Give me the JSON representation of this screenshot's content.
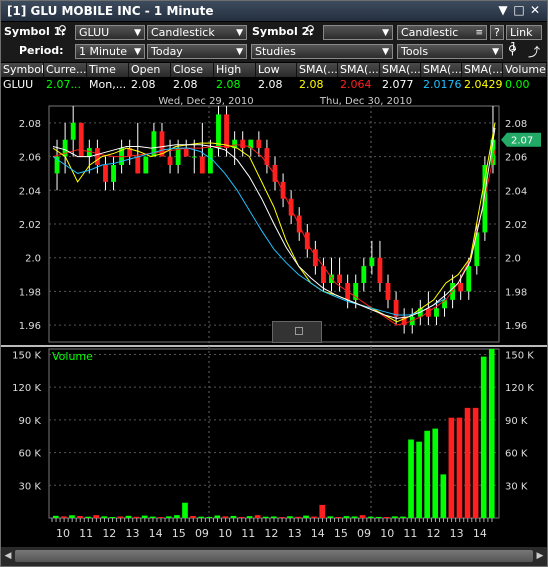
{
  "window": {
    "title": "[1] GLU MOBILE INC - 1 Minute",
    "buttons": [
      "▼",
      "□",
      "✕"
    ]
  },
  "toolbar": {
    "symbol1_label": "Symbol 1:",
    "symbol1_value": "GLUU",
    "chart_style_1": "Candlestick",
    "symbol2_label": "Symbol 2:",
    "symbol2_value": "",
    "chart_style_2": "Candlestic",
    "help_label": "?",
    "link_label": "Link 1",
    "period_label": "Period:",
    "interval": "1 Minute",
    "range": "Today",
    "studies": "Studies",
    "tools": "Tools"
  },
  "quote": {
    "headers": [
      "Symbol",
      "Curre...",
      "Time",
      "Open",
      "Close",
      "High",
      "Low",
      "SMA(...",
      "SMA(...",
      "SMA(...",
      "SMA(...",
      "SMA(...",
      "Volume"
    ],
    "values": [
      "GLUU",
      "2.07...",
      "Mon,...",
      "2.08",
      "2.08",
      "2.08",
      "2.08",
      "2.08",
      "2.064",
      "2.077",
      "2.0176",
      "2.0429",
      "0.00"
    ],
    "colors": [
      "#ffffff",
      "#00ff00",
      "#ffffff",
      "#ffffff",
      "#ffffff",
      "#00ff00",
      "#ffffff",
      "#ffff00",
      "#ff2020",
      "#ffffff",
      "#20c0ff",
      "#ffff00",
      "#00ff00"
    ]
  },
  "chart_data": {
    "type": "candlestick",
    "date_labels": [
      "Wed, Dec 29, 2010",
      "Thu, Dec 30, 2010"
    ],
    "price_axis": {
      "ticks": [
        "2.08",
        "2.06",
        "2.04",
        "2.02",
        "2.0",
        "1.98",
        "1.96"
      ],
      "ylim": [
        1.95,
        2.09
      ]
    },
    "current_price_tag": "2.07",
    "volume_label": "Volume",
    "volume_axis": {
      "ticks": [
        "150 K",
        "120 K",
        "90 K",
        "60 K",
        "30 K"
      ],
      "ylim": [
        0,
        155000
      ]
    },
    "x_ticks": [
      "10",
      "11",
      "12",
      "13",
      "14",
      "15",
      "09",
      "10",
      "11",
      "12",
      "13",
      "14",
      "15",
      "09",
      "10",
      "11",
      "12",
      "13",
      "14"
    ],
    "candles": [
      [
        2.05,
        2.07,
        2.04,
        2.06
      ],
      [
        2.06,
        2.08,
        2.05,
        2.07
      ],
      [
        2.07,
        2.09,
        2.06,
        2.08
      ],
      [
        2.08,
        2.08,
        2.06,
        2.06
      ],
      [
        2.06,
        2.07,
        2.05,
        2.065
      ],
      [
        2.065,
        2.07,
        2.05,
        2.055
      ],
      [
        2.055,
        2.06,
        2.04,
        2.045
      ],
      [
        2.045,
        2.06,
        2.04,
        2.055
      ],
      [
        2.055,
        2.07,
        2.05,
        2.065
      ],
      [
        2.065,
        2.07,
        2.055,
        2.06
      ],
      [
        2.06,
        2.08,
        2.05,
        2.05
      ],
      [
        2.05,
        2.06,
        2.05,
        2.06
      ],
      [
        2.06,
        2.08,
        2.06,
        2.075
      ],
      [
        2.075,
        2.08,
        2.06,
        2.06
      ],
      [
        2.06,
        2.07,
        2.05,
        2.055
      ],
      [
        2.055,
        2.07,
        2.05,
        2.065
      ],
      [
        2.065,
        2.07,
        2.06,
        2.06
      ],
      [
        2.06,
        2.07,
        2.05,
        2.06
      ],
      [
        2.06,
        2.08,
        2.05,
        2.05
      ],
      [
        2.05,
        2.07,
        2.05,
        2.065
      ],
      [
        2.065,
        2.09,
        2.06,
        2.085
      ],
      [
        2.085,
        2.09,
        2.06,
        2.065
      ],
      [
        2.065,
        2.075,
        2.055,
        2.07
      ],
      [
        2.07,
        2.075,
        2.06,
        2.065
      ],
      [
        2.065,
        2.07,
        2.06,
        2.07
      ],
      [
        2.07,
        2.075,
        2.06,
        2.065
      ],
      [
        2.065,
        2.07,
        2.05,
        2.055
      ],
      [
        2.055,
        2.06,
        2.04,
        2.045
      ],
      [
        2.045,
        2.05,
        2.03,
        2.035
      ],
      [
        2.035,
        2.04,
        2.02,
        2.025
      ],
      [
        2.025,
        2.03,
        2.01,
        2.015
      ],
      [
        2.015,
        2.02,
        2.0,
        2.005
      ],
      [
        2.005,
        2.01,
        1.99,
        1.995
      ],
      [
        1.995,
        2.0,
        1.98,
        1.985
      ],
      [
        1.985,
        2.0,
        1.98,
        1.99
      ],
      [
        1.99,
        2.0,
        1.98,
        1.985
      ],
      [
        1.985,
        1.99,
        1.97,
        1.975
      ],
      [
        1.975,
        1.99,
        1.97,
        1.985
      ],
      [
        1.985,
        2.0,
        1.98,
        1.995
      ],
      [
        1.995,
        2.01,
        1.99,
        2.0
      ],
      [
        2.0,
        2.01,
        1.98,
        1.985
      ],
      [
        1.985,
        1.99,
        1.97,
        1.975
      ],
      [
        1.975,
        1.98,
        1.96,
        1.965
      ],
      [
        1.965,
        1.97,
        1.955,
        1.96
      ],
      [
        1.96,
        1.97,
        1.955,
        1.965
      ],
      [
        1.965,
        1.975,
        1.96,
        1.97
      ],
      [
        1.97,
        1.98,
        1.96,
        1.965
      ],
      [
        1.965,
        1.975,
        1.96,
        1.97
      ],
      [
        1.97,
        1.98,
        1.965,
        1.975
      ],
      [
        1.975,
        1.99,
        1.97,
        1.985
      ],
      [
        1.985,
        1.99,
        1.975,
        1.98
      ],
      [
        1.98,
        2.0,
        1.975,
        1.995
      ],
      [
        1.995,
        2.02,
        1.99,
        2.015
      ],
      [
        2.015,
        2.06,
        2.01,
        2.055
      ],
      [
        2.055,
        2.09,
        2.05,
        2.07
      ]
    ],
    "sma_series": [
      {
        "color": "#ff2020",
        "values": [
          2.06,
          2.062,
          2.064,
          2.063,
          2.061,
          2.06,
          2.06,
          2.061,
          2.062,
          2.063,
          2.064,
          2.065,
          2.065,
          2.066,
          2.066,
          2.067,
          2.066,
          2.06,
          2.05,
          2.035,
          2.02,
          2.005,
          1.995,
          1.985,
          1.98,
          1.975,
          1.97,
          1.965,
          1.96,
          1.962,
          1.965,
          1.97,
          1.975,
          1.985,
          2.0,
          2.03,
          2.064
        ]
      },
      {
        "color": "#ffff00",
        "values": [
          2.065,
          2.06,
          2.045,
          2.055,
          2.06,
          2.062,
          2.065,
          2.063,
          2.06,
          2.062,
          2.066,
          2.067,
          2.068,
          2.068,
          2.067,
          2.065,
          2.06,
          2.045,
          2.03,
          2.01,
          1.995,
          1.985,
          1.98,
          1.978,
          1.975,
          1.972,
          1.97,
          1.966,
          1.962,
          1.965,
          1.97,
          1.975,
          1.985,
          1.99,
          2.0,
          2.04,
          2.08
        ]
      },
      {
        "color": "#20c0ff",
        "values": [
          2.06,
          2.055,
          2.05,
          2.052,
          2.055,
          2.056,
          2.058,
          2.06,
          2.062,
          2.064,
          2.065,
          2.065,
          2.063,
          2.058,
          2.05,
          2.04,
          2.028,
          2.016,
          2.005,
          1.997,
          1.99,
          1.985,
          1.98,
          1.977,
          1.974,
          1.972,
          1.97,
          1.968,
          1.966,
          1.966,
          1.968,
          1.972,
          1.976,
          null,
          null,
          null,
          null
        ]
      },
      {
        "color": "#ffffff",
        "values": [
          2.066,
          2.064,
          2.06,
          2.06,
          2.062,
          2.064,
          2.066,
          2.066,
          2.065,
          2.066,
          2.067,
          2.067,
          2.067,
          2.066,
          2.064,
          2.058,
          2.048,
          2.035,
          2.02,
          2.006,
          1.995,
          1.988,
          1.982,
          1.978,
          1.975,
          1.972,
          1.969,
          1.966,
          1.964,
          1.965,
          1.968,
          1.972,
          1.978,
          1.985,
          1.998,
          2.03,
          2.077
        ]
      }
    ],
    "volume": [
      2000,
      1500,
      2500,
      1800,
      1200,
      2600,
      1500,
      900,
      1400,
      2000,
      1100,
      2200,
      1300,
      800,
      1500,
      2600,
      14000,
      1800,
      1200,
      900,
      2300,
      1500,
      1900,
      1000,
      1700,
      2600,
      1200,
      1400,
      900,
      1600,
      1100,
      2200,
      1300,
      12000,
      1500,
      900,
      1700,
      1400,
      2600,
      1200,
      1000,
      900,
      1500,
      1300,
      72000,
      70000,
      80000,
      82000,
      40000,
      92000,
      92000,
      101000,
      101000,
      148000,
      155000
    ],
    "volume_up": [
      true,
      false,
      true,
      false,
      true,
      false,
      true,
      true,
      false,
      true,
      false,
      true,
      true,
      false,
      true,
      true,
      true,
      false,
      true,
      true,
      true,
      false,
      true,
      false,
      true,
      false,
      true,
      true,
      false,
      true,
      false,
      true,
      false,
      false,
      true,
      false,
      true,
      true,
      false,
      true,
      true,
      false,
      true,
      true,
      true,
      true,
      true,
      true,
      true,
      false,
      false,
      false,
      false,
      true,
      true
    ]
  }
}
